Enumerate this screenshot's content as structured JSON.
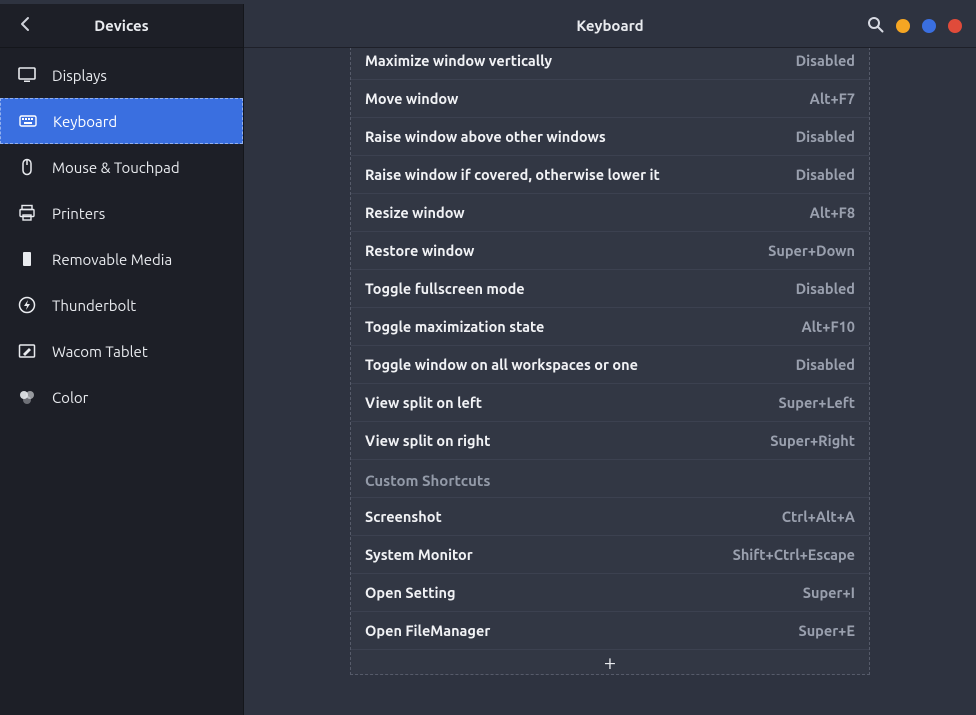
{
  "sidebar": {
    "title": "Devices",
    "items": [
      {
        "label": "Displays",
        "icon": "display-icon"
      },
      {
        "label": "Keyboard",
        "icon": "keyboard-icon",
        "active": true
      },
      {
        "label": "Mouse & Touchpad",
        "icon": "mouse-icon"
      },
      {
        "label": "Printers",
        "icon": "printer-icon"
      },
      {
        "label": "Removable Media",
        "icon": "removable-media-icon"
      },
      {
        "label": "Thunderbolt",
        "icon": "thunderbolt-icon"
      },
      {
        "label": "Wacom Tablet",
        "icon": "tablet-icon"
      },
      {
        "label": "Color",
        "icon": "color-icon"
      }
    ]
  },
  "header": {
    "title": "Keyboard"
  },
  "shortcuts": {
    "windows": [
      {
        "label": "Maximize window vertically",
        "accel": "Disabled"
      },
      {
        "label": "Move window",
        "accel": "Alt+F7"
      },
      {
        "label": "Raise window above other windows",
        "accel": "Disabled"
      },
      {
        "label": "Raise window if covered, otherwise lower it",
        "accel": "Disabled"
      },
      {
        "label": "Resize window",
        "accel": "Alt+F8"
      },
      {
        "label": "Restore window",
        "accel": "Super+Down"
      },
      {
        "label": "Toggle fullscreen mode",
        "accel": "Disabled"
      },
      {
        "label": "Toggle maximization state",
        "accel": "Alt+F10"
      },
      {
        "label": "Toggle window on all workspaces or one",
        "accel": "Disabled"
      },
      {
        "label": "View split on left",
        "accel": "Super+Left"
      },
      {
        "label": "View split on right",
        "accel": "Super+Right"
      }
    ],
    "custom_section_title": "Custom Shortcuts",
    "custom": [
      {
        "label": "Screenshot",
        "accel": "Ctrl+Alt+A"
      },
      {
        "label": "System Monitor",
        "accel": "Shift+Ctrl+Escape"
      },
      {
        "label": "Open Setting",
        "accel": "Super+I"
      },
      {
        "label": "Open FileManager",
        "accel": "Super+E"
      }
    ],
    "add_label": "+"
  }
}
